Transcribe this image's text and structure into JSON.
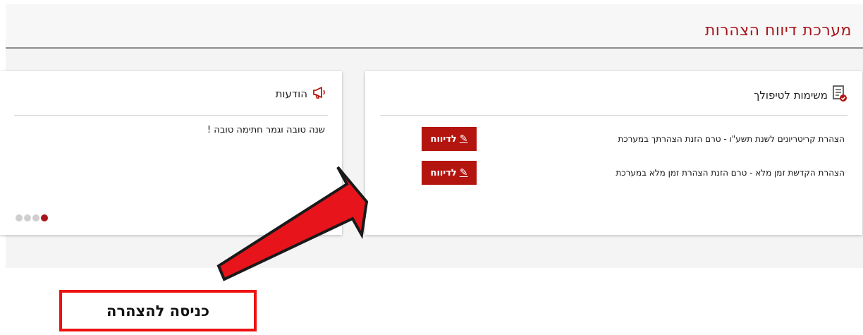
{
  "header": {
    "title": "מערכת דיווח הצהרות"
  },
  "tasks_panel": {
    "title": "משימות לטיפולך",
    "icon": "document-check-icon",
    "items": [
      {
        "text": "הצהרת קריטריונים לשנת תשע\"ו - טרם הזנת הצהרתך במערכת",
        "button_label": "לדיווח"
      },
      {
        "text": "הצהרת הקדשת זמן מלא - טרם הזנת הצהרת זמן מלא במערכת",
        "button_label": "לדיווח"
      }
    ]
  },
  "news_panel": {
    "title": "הודעות",
    "icon": "megaphone-icon",
    "message": "שנה טובה וגמר חתימה טובה !",
    "carousel": {
      "total": 4,
      "active_index": 0
    }
  },
  "annotation": {
    "label": "כניסה להצהרה",
    "arrow_color": "#e8141b",
    "border_color": "#ee1111"
  },
  "colors": {
    "brand": "#a8161b",
    "button": "#b4150f"
  }
}
